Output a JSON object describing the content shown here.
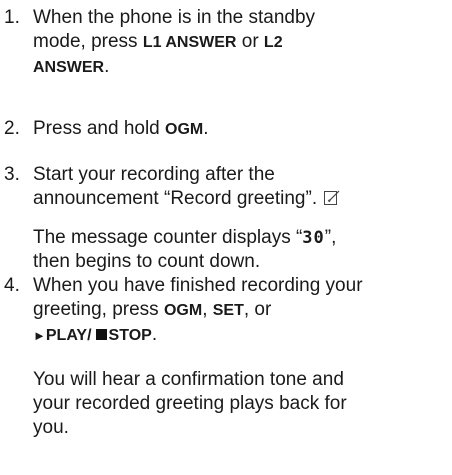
{
  "steps": [
    {
      "number": "1.",
      "lines": {
        "a": "When the phone is in the standby",
        "b_pre": "mode, press ",
        "b_btn1": "L1 ANSWER",
        "b_mid": " or ",
        "b_btn2": "L2",
        "c_btn2": "ANSWER",
        "c_post": "."
      }
    },
    {
      "number": "2.",
      "pre": "Press and hold ",
      "button": "OGM",
      "post": "."
    },
    {
      "number": "3.",
      "line1": "Start your recording after the",
      "line2": "announcement “Record greeting”.",
      "note_icon": "note-icon",
      "sub_pre": "The message counter displays “",
      "counter": "30",
      "sub_post": "”,",
      "sub_line2": "then begins to count down."
    },
    {
      "number": "4.",
      "line1": "When you have finished recording your",
      "line2_pre": "greeting, press ",
      "btn_ogm": "OGM",
      "sep1": ", ",
      "btn_set": "SET",
      "sep2": ", or",
      "play_glyph": "►",
      "btn_play": "PLAY/",
      "btn_stop": "STOP",
      "line3_post": ".",
      "sub_line1": "You will hear a confirmation tone and",
      "sub_line2": "your recorded greeting plays back for",
      "sub_line3": "you."
    }
  ],
  "colors": {
    "text": "#1a1a1a",
    "background": "#ffffff"
  }
}
